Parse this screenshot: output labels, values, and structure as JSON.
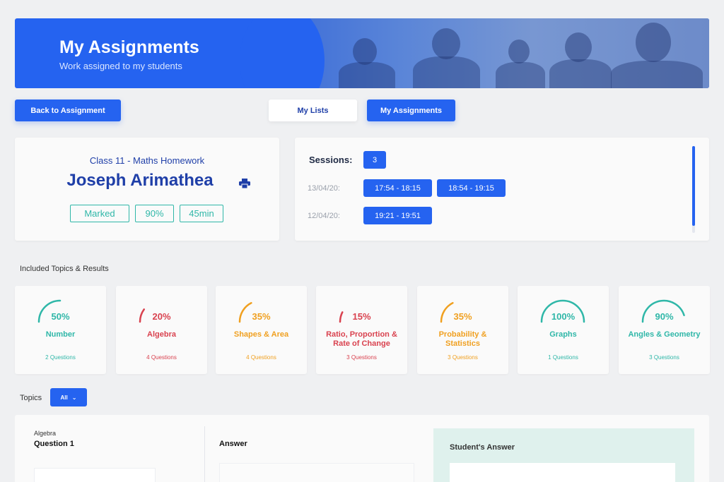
{
  "banner": {
    "title": "My Assignments",
    "subtitle": "Work assigned to my students"
  },
  "buttons": {
    "back": "Back to Assignment",
    "my_lists": "My Lists",
    "my_assignments": "My Assignments"
  },
  "student": {
    "class_title": "Class 11 - Maths Homework",
    "name": "Joseph Arimathea",
    "tags": [
      "Marked",
      "90%",
      "45min"
    ]
  },
  "sessions": {
    "label": "Sessions:",
    "count": "3",
    "rows": [
      {
        "date": "13/04/20:",
        "times": [
          "17:54 - 18:15",
          "18:54 - 19:15"
        ]
      },
      {
        "date": "12/04/20:",
        "times": [
          "19:21 - 19:51"
        ]
      }
    ]
  },
  "topics_section": {
    "title": "Included Topics & Results",
    "items": [
      {
        "percent": "50%",
        "value": 50,
        "name": "Number",
        "questions": "2 Questions",
        "color": "#2fb7a8"
      },
      {
        "percent": "20%",
        "value": 20,
        "name": "Algebra",
        "questions": "4 Questions",
        "color": "#d9424f"
      },
      {
        "percent": "35%",
        "value": 35,
        "name": "Shapes & Area",
        "questions": "4 Questions",
        "color": "#f0a020"
      },
      {
        "percent": "15%",
        "value": 15,
        "name": "Ratio, Proportion & Rate of Change",
        "questions": "3 Questions",
        "color": "#d9424f"
      },
      {
        "percent": "35%",
        "value": 35,
        "name": "Probability & Statistics",
        "questions": "3 Questions",
        "color": "#f0a020"
      },
      {
        "percent": "100%",
        "value": 100,
        "name": "Graphs",
        "questions": "1 Questions",
        "color": "#2fb7a8"
      },
      {
        "percent": "90%",
        "value": 90,
        "name": "Angles & Geometry",
        "questions": "3 Questions",
        "color": "#2fb7a8"
      }
    ]
  },
  "filter": {
    "label": "Topics",
    "selected": "All"
  },
  "question": {
    "topic": "Algebra",
    "title": "Question 1",
    "answer_label": "Answer",
    "student_answer_label": "Student's Answer"
  }
}
